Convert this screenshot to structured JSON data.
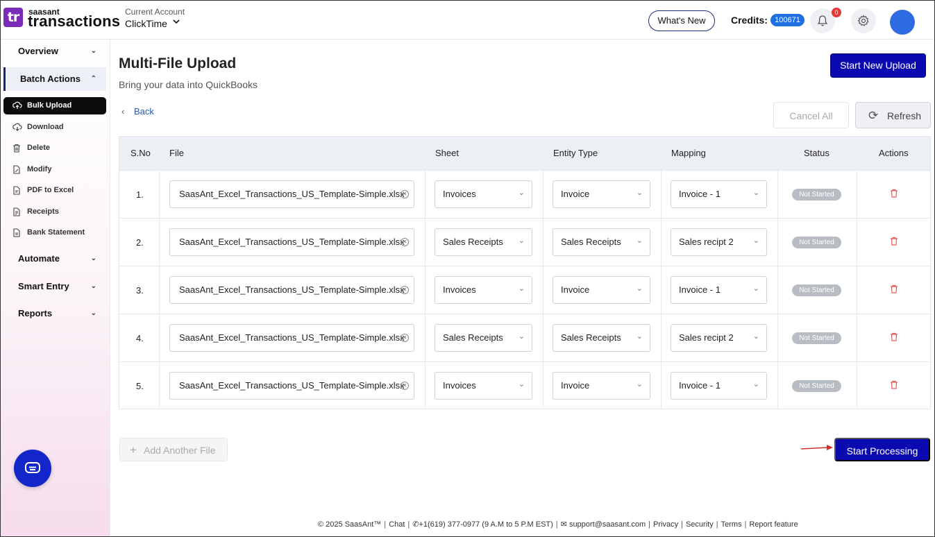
{
  "header": {
    "logo_mark": "tr",
    "logo_small": "saasant",
    "logo_big": "transactions",
    "account_label": "Current Account",
    "account_value": "ClickTime",
    "whats_new_label": "What's New",
    "credits_label": "Credits:",
    "credits_value": "100671",
    "notification_count": "0"
  },
  "sidebar": {
    "groups": [
      {
        "label": "Overview"
      },
      {
        "label": "Batch Actions"
      },
      {
        "label": "Automate"
      },
      {
        "label": "Smart Entry"
      },
      {
        "label": "Reports"
      }
    ],
    "items": [
      {
        "label": "Bulk Upload",
        "icon": "cloud-upload-icon"
      },
      {
        "label": "Download",
        "icon": "cloud-download-icon"
      },
      {
        "label": "Delete",
        "icon": "trash-icon"
      },
      {
        "label": "Modify",
        "icon": "edit-icon"
      },
      {
        "label": "PDF to Excel",
        "icon": "pdf-icon"
      },
      {
        "label": "Receipts",
        "icon": "receipt-icon"
      },
      {
        "label": "Bank Statement",
        "icon": "bank-statement-icon"
      }
    ]
  },
  "main": {
    "title": "Multi-File Upload",
    "subtitle": "Bring your data into QuickBooks",
    "start_new_upload_label": "Start New Upload",
    "back_label": "Back",
    "cancel_all_label": "Cancel All",
    "refresh_label": "Refresh",
    "columns": [
      "S.No",
      "File",
      "Sheet",
      "Entity Type",
      "Mapping",
      "Status",
      "Actions"
    ],
    "rows": [
      {
        "sno": "1.",
        "file": "SaasAnt_Excel_Transactions_US_Template-Simple.xlsx",
        "sheet": "Invoices",
        "entity": "Invoice",
        "mapping": "Invoice - 1",
        "status": "Not Started"
      },
      {
        "sno": "2.",
        "file": "SaasAnt_Excel_Transactions_US_Template-Simple.xlsx",
        "sheet": "Sales Receipts",
        "entity": "Sales Receipts",
        "mapping": "Sales recipt 2",
        "status": "Not Started"
      },
      {
        "sno": "3.",
        "file": "SaasAnt_Excel_Transactions_US_Template-Simple.xlsx",
        "sheet": "Invoices",
        "entity": "Invoice",
        "mapping": "Invoice - 1",
        "status": "Not Started"
      },
      {
        "sno": "4.",
        "file": "SaasAnt_Excel_Transactions_US_Template-Simple.xlsx",
        "sheet": "Sales Receipts",
        "entity": "Sales Receipts",
        "mapping": "Sales recipt 2",
        "status": "Not Started"
      },
      {
        "sno": "5.",
        "file": "SaasAnt_Excel_Transactions_US_Template-Simple.xlsx",
        "sheet": "Invoices",
        "entity": "Invoice",
        "mapping": "Invoice - 1",
        "status": "Not Started"
      }
    ],
    "add_file_label": "Add Another File",
    "start_processing_label": "Start Processing"
  },
  "footer": {
    "copyright": "© 2025 SaasAnt™",
    "chat": "Chat",
    "phone": "+1(619) 377-0977 (9 A.M to 5 P.M EST)",
    "email": "support@saasant.com",
    "privacy": "Privacy",
    "security": "Security",
    "terms": "Terms",
    "report": "Report feature"
  },
  "colors": {
    "primary_button": "#0a0ab0",
    "credits_badge": "#1f6fe0",
    "notification_badge": "#e53935",
    "delete_icon": "#e05a5a",
    "logo": "#7a2bb8"
  }
}
